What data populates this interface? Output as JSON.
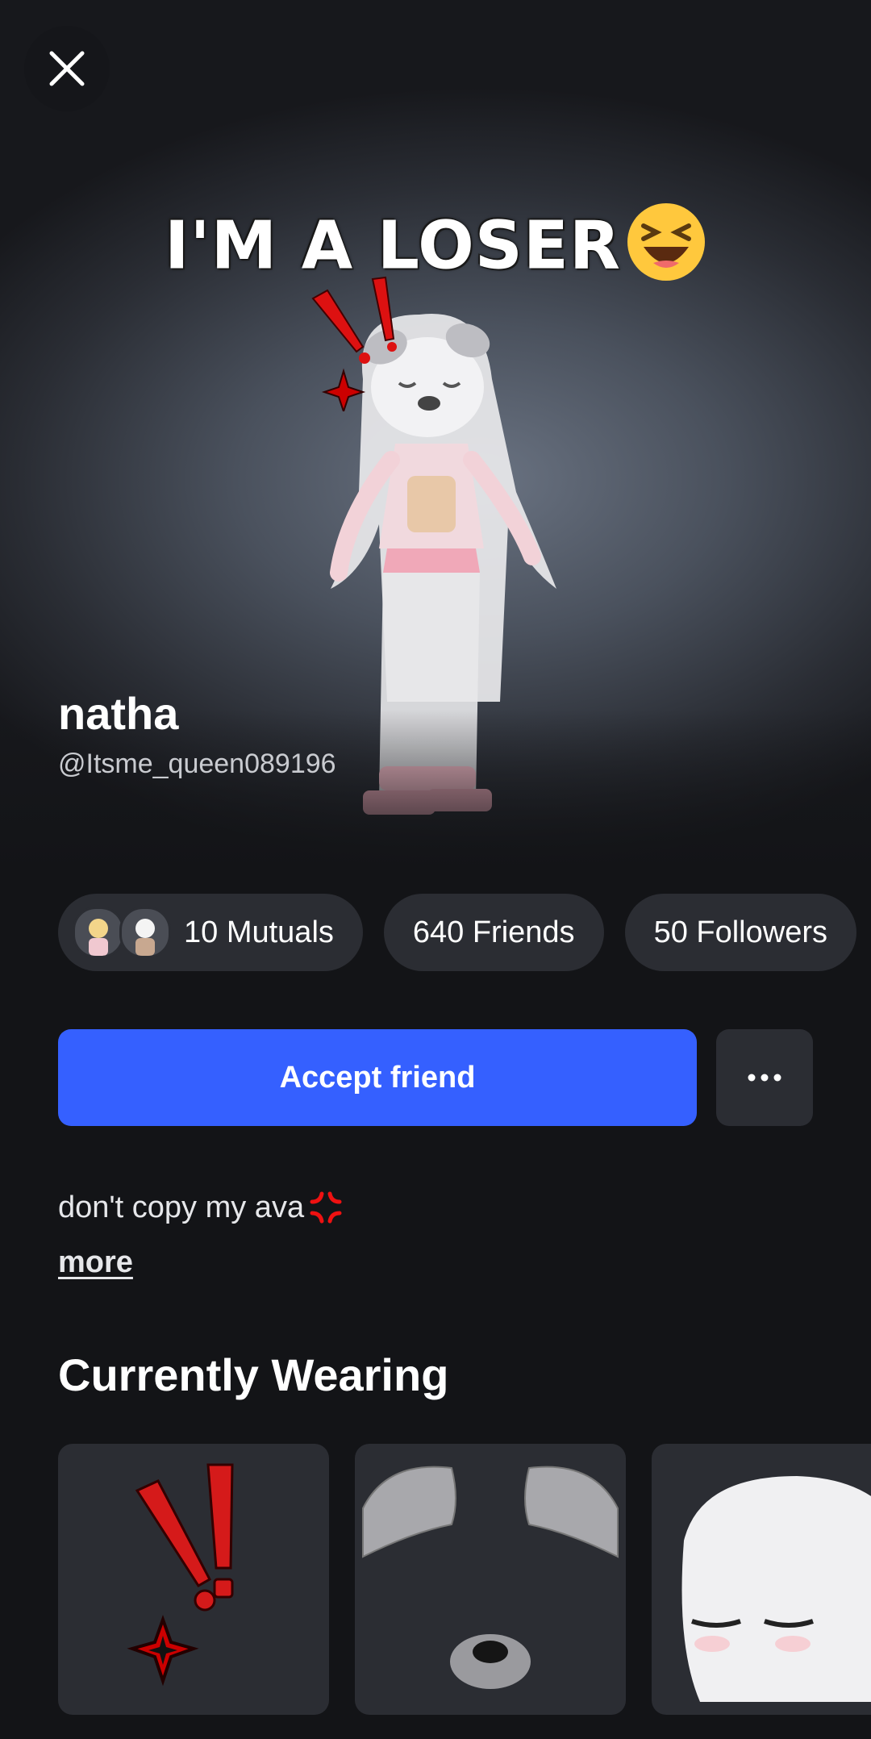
{
  "caption": {
    "text": "I'M A LOSER",
    "emoji": "laughing-face-emoji"
  },
  "profile": {
    "display_name": "natha",
    "username": "@Itsme_queen089196",
    "bio": "don't copy my ava",
    "bio_emoji": "anger-symbol-emoji",
    "more_label": "more"
  },
  "stats": {
    "mutuals_label": "10 Mutuals",
    "friends_label": "640 Friends",
    "followers_label": "50 Followers"
  },
  "actions": {
    "accept_label": "Accept friend",
    "more_icon": "ellipsis-icon"
  },
  "wearing": {
    "title": "Currently Wearing",
    "items": [
      {
        "icon": "exclamation-anger-accessory-icon"
      },
      {
        "icon": "dog-ears-nose-accessory-icon"
      },
      {
        "icon": "sleepy-head-icon"
      }
    ]
  },
  "colors": {
    "accent": "#3560ff",
    "background": "#131417",
    "card": "#2b2d33"
  }
}
